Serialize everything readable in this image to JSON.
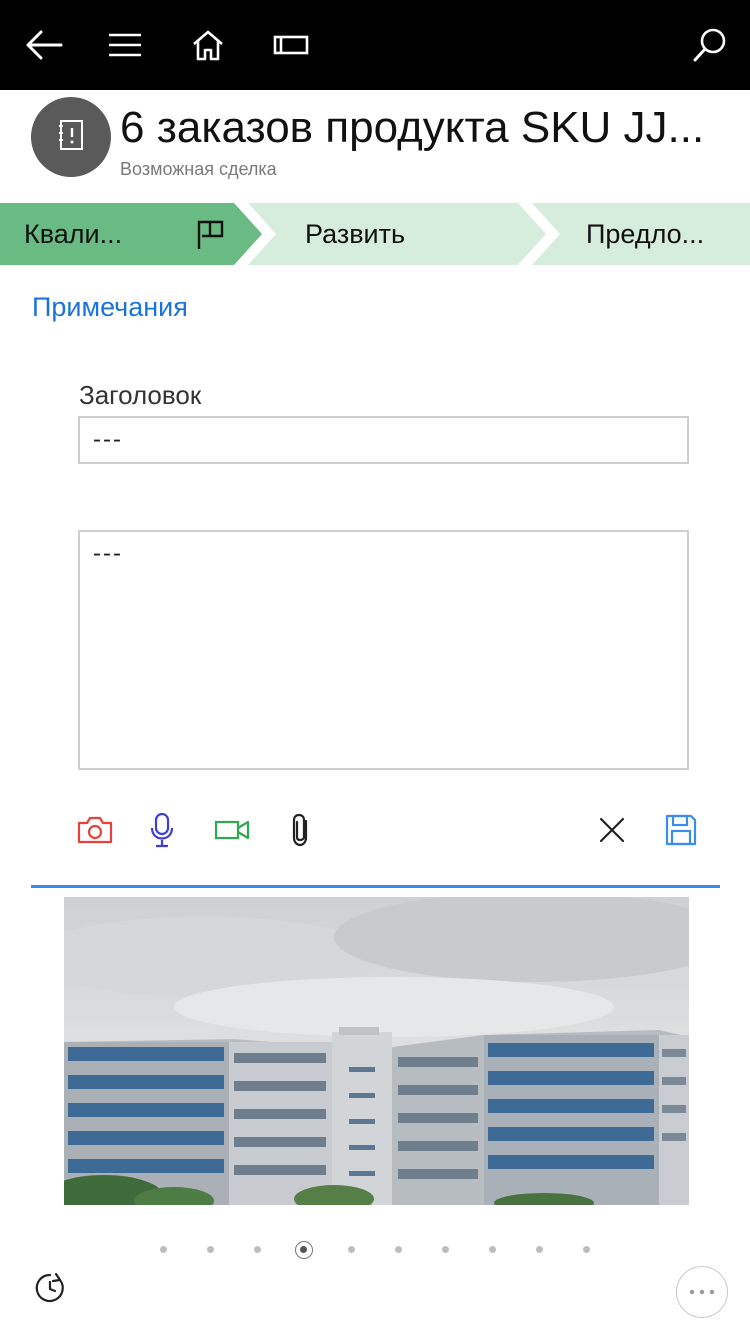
{
  "nav": {
    "icons": [
      "back-arrow-icon",
      "hamburger-menu-icon",
      "home-icon",
      "window-switch-icon",
      "search-icon"
    ]
  },
  "record": {
    "icon": "opportunity-icon",
    "title": "6 заказов продукта SKU JJ...",
    "subtitle": "Возможная сделка"
  },
  "process": {
    "stages": [
      {
        "label": "Квали...",
        "state": "active",
        "icon": "flag-icon"
      },
      {
        "label": "Развить",
        "state": "inactive"
      },
      {
        "label": "Предло...",
        "state": "inactive"
      }
    ],
    "colors": {
      "active": "#69bb83",
      "inactive": "#d6ecdd"
    }
  },
  "notes": {
    "section_title": "Примечания",
    "title_label": "Заголовок",
    "title_value": "---",
    "body_value": "---"
  },
  "toolbar": {
    "icons": [
      "camera-icon",
      "microphone-icon",
      "video-icon",
      "paperclip-icon",
      "close-icon",
      "save-icon"
    ],
    "colors": {
      "camera": "#e8413c",
      "microphone": "#3d3dd8",
      "video": "#2fa84f",
      "save": "#3a8ee8",
      "accent": "#3a8ee8"
    }
  },
  "gallery": {
    "dot_count": 10,
    "active_dot": 4
  },
  "footer": {
    "icons": [
      "history-clock-icon",
      "more-ellipsis-icon"
    ]
  }
}
